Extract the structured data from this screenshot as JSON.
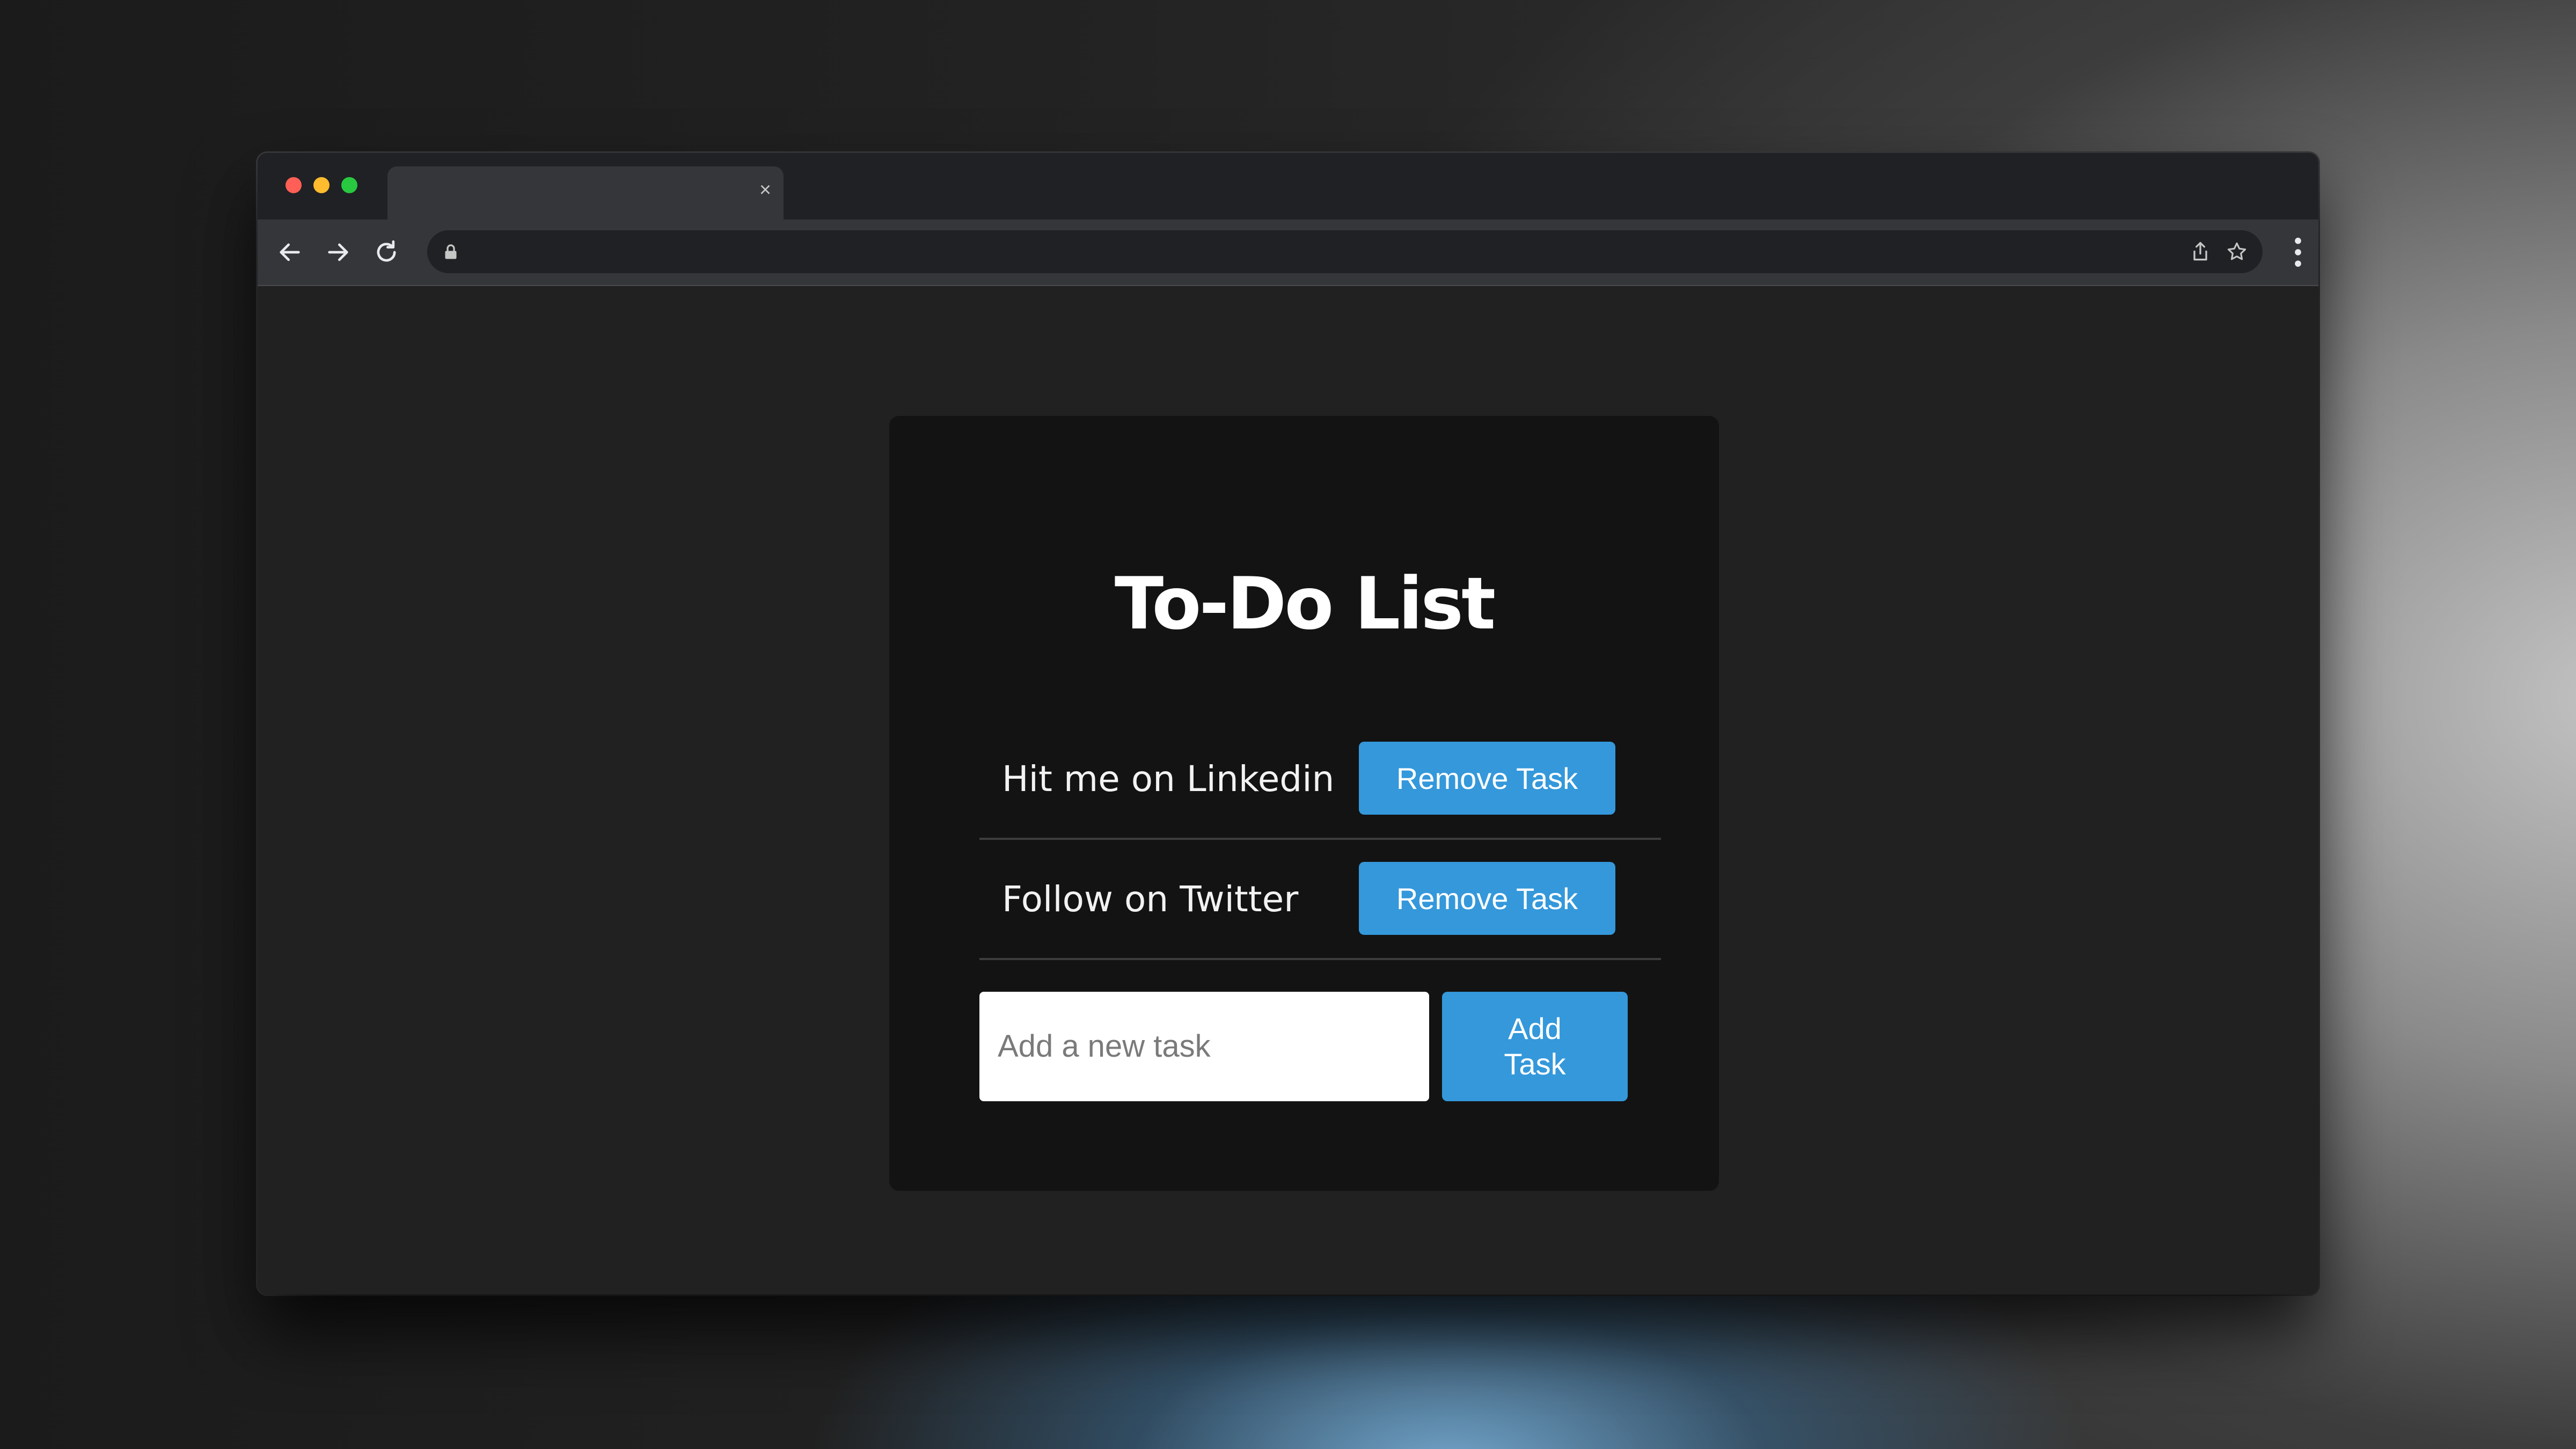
{
  "browser": {
    "tab_close_glyph": "×",
    "icons": [
      "back-arrow-icon",
      "forward-arrow-icon",
      "reload-icon",
      "lock-icon",
      "share-icon",
      "star-icon",
      "more-options-icon"
    ]
  },
  "page": {
    "title": "To-Do List",
    "tasks": [
      {
        "text": "Hit me on Linkedin",
        "remove_label": "Remove Task"
      },
      {
        "text": "Follow on Twitter",
        "remove_label": "Remove Task"
      }
    ],
    "input": {
      "placeholder": "Add a new task",
      "value": ""
    },
    "add_label": "Add Task"
  },
  "colors": {
    "accent": "#3498db",
    "card_bg": "#131313",
    "page_bg": "#212121",
    "text": "#ffffff"
  }
}
